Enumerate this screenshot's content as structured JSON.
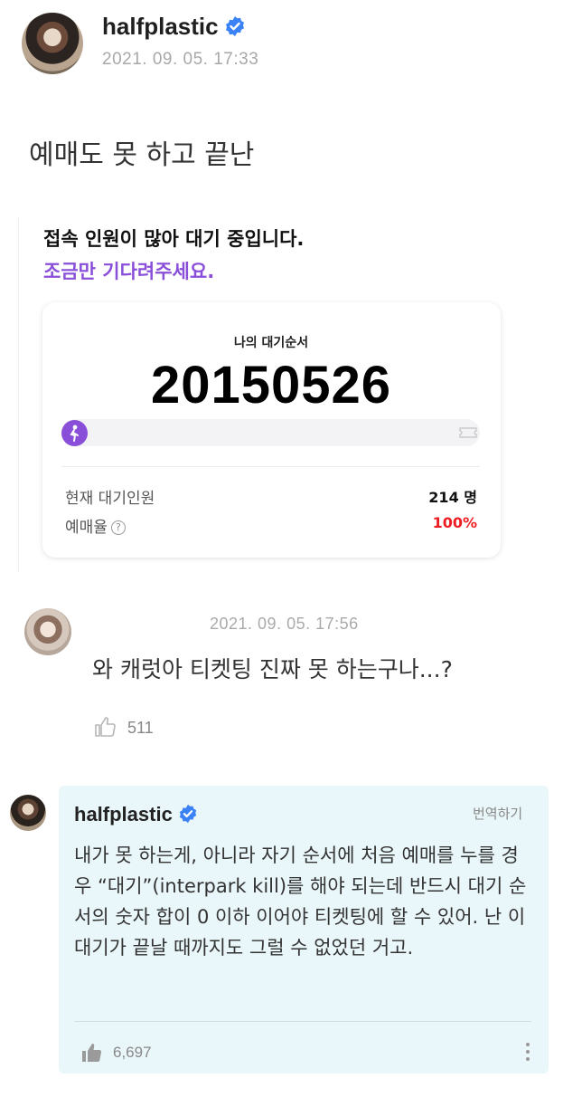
{
  "post": {
    "username": "halfplastic",
    "timestamp": "2021. 09. 05. 17:33",
    "text": "예매도 못 하고 끝난"
  },
  "embed": {
    "title": "접속 인원이 많아 대기 중입니다.",
    "subtitle": "조금만 기다려주세요.",
    "queue_label": "나의 대기순서",
    "queue_number": "20150526",
    "progress_fraction": 0.0,
    "rows": [
      {
        "label": "현재 대기인원",
        "value": "214 명"
      },
      {
        "label": "예매율",
        "value": "100%",
        "help": "?"
      }
    ],
    "colors": {
      "accent": "#8a4fd8",
      "rate": "#ee1d23"
    },
    "icons": [
      "runner-icon",
      "ticket-icon",
      "help-icon"
    ]
  },
  "comment": {
    "timestamp": "2021. 09. 05. 17:56",
    "text": "와 캐럿아 티켓팅 진짜 못 하는구나...?",
    "likes": "511"
  },
  "reply": {
    "username": "halfplastic",
    "translate_label": "번역하기",
    "text": "내가 못 하는게, 아니라 자기 순서에 처음 예매를 누를 경우 “대기”(interpark kill)를 해야 되는데 반드시 대기 순서의 숫자 합이 0 이하 이어야 티켓팅에 할 수 있어. 난 이 대기가 끝날 때까지도 그럴 수 없었던 거고.",
    "likes": "6,697"
  },
  "colors": {
    "verified": "#3b82f6",
    "reply_bg": "#eaf7fa"
  }
}
